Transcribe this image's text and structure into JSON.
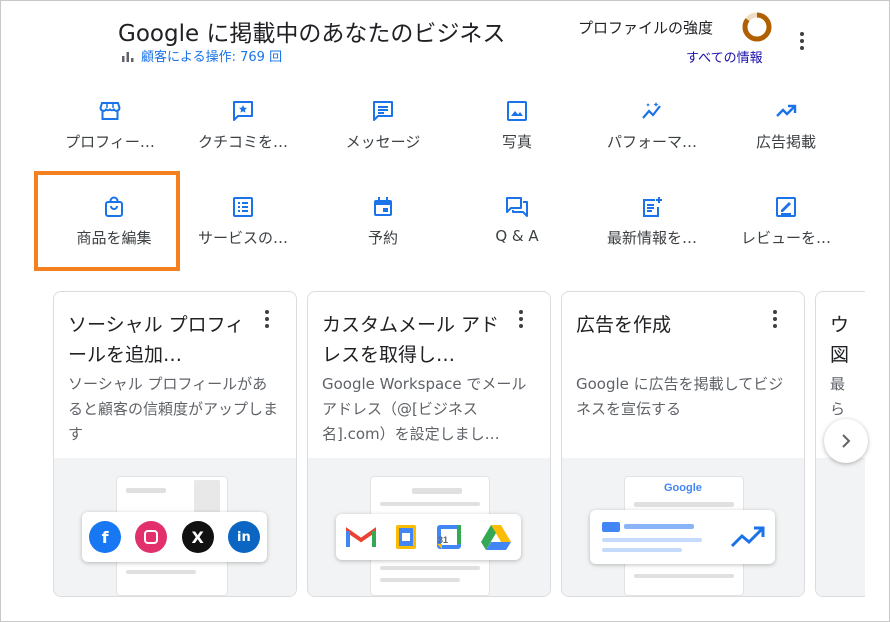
{
  "header": {
    "title": "Google に掲載中のあなたのビジネス",
    "interactions": "顧客による操作: 769 回",
    "profile_strength_label": "プロファイルの強度",
    "all_info_link": "すべての情報"
  },
  "actions_row1": [
    {
      "label": "プロフィー…",
      "icon": "storefront-icon"
    },
    {
      "label": "クチコミを…",
      "icon": "star-review-icon"
    },
    {
      "label": "メッセージ",
      "icon": "message-icon"
    },
    {
      "label": "写真",
      "icon": "photo-icon"
    },
    {
      "label": "パフォーマ…",
      "icon": "performance-icon"
    },
    {
      "label": "広告掲載",
      "icon": "trending-up-icon"
    }
  ],
  "actions_row2": [
    {
      "label": "商品を編集",
      "icon": "shopping-bag-icon"
    },
    {
      "label": "サービスの…",
      "icon": "list-icon"
    },
    {
      "label": "予約",
      "icon": "calendar-icon"
    },
    {
      "label": "Q & A",
      "icon": "qa-icon"
    },
    {
      "label": "最新情報を…",
      "icon": "add-post-icon"
    },
    {
      "label": "レビューを…",
      "icon": "review-edit-icon"
    }
  ],
  "cards": [
    {
      "title": "ソーシャル プロフィールを追加…",
      "desc": "ソーシャル プロフィールがあると顧客の信頼度がアップします"
    },
    {
      "title": "カスタムメール アドレスを取得し…",
      "desc": "Google Workspace でメールアドレス（@[ビジネス名].com）を設定しまし…"
    },
    {
      "title": "広告を作成",
      "desc": "Google に広告を掲載してビジネスを宣伝する"
    }
  ],
  "partial_card": {
    "title": "ウ\n図",
    "desc": "最\nら"
  },
  "illustration_text": {
    "google_logo": "Google",
    "calendar_day": "31"
  },
  "colors": {
    "accent_blue": "#1a73e8",
    "highlight_orange": "#f4801f",
    "ring_brown": "#b06000"
  },
  "profile_strength_fraction": 0.85
}
